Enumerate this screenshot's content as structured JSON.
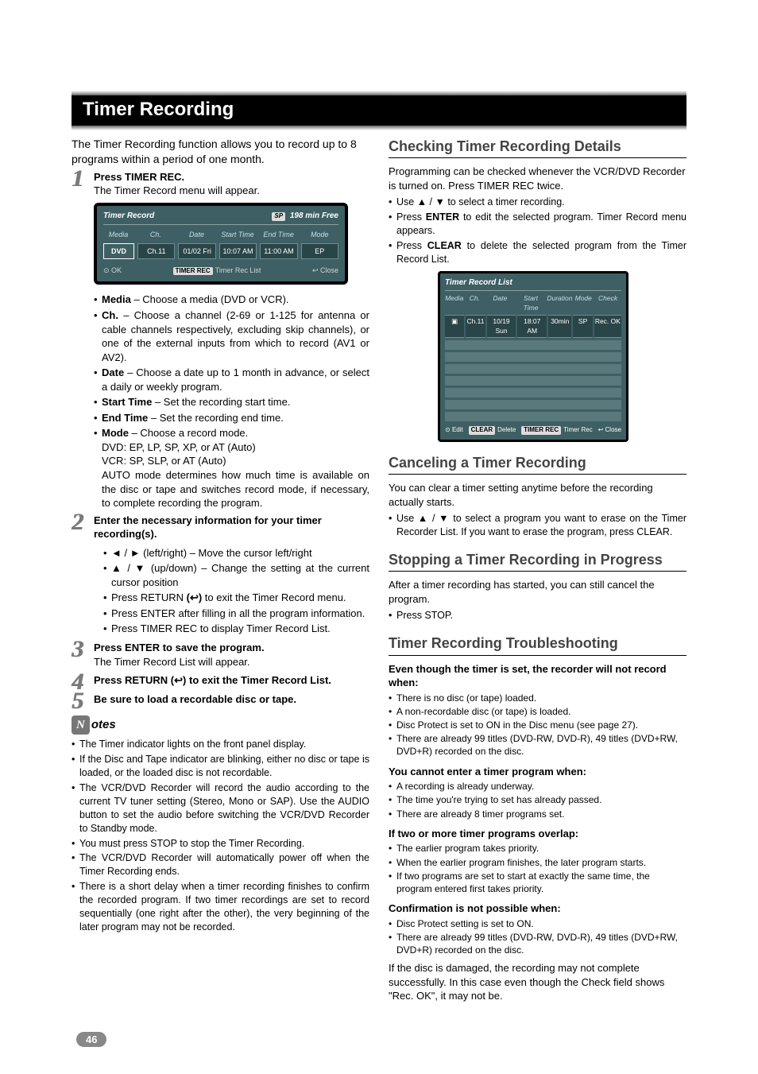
{
  "page": {
    "number": "46",
    "title": "Timer Recording"
  },
  "left": {
    "intro": "The Timer Recording function allows you to record up to 8 programs within a period of one month.",
    "step1": {
      "head": "Press TIMER REC.",
      "sub": "The Timer Record menu will appear."
    },
    "osd1": {
      "title": "Timer Record",
      "sp": "SP",
      "free": "198   min Free",
      "hdr": {
        "media": "Media",
        "ch": "Ch.",
        "date": "Date",
        "start": "Start Time",
        "end": "End Time",
        "mode": "Mode"
      },
      "row": {
        "media": "DVD",
        "ch": "Ch.11",
        "date": "01/02 Fri",
        "start": "10:07 AM",
        "end": "11:00 AM",
        "mode": "EP"
      },
      "foot": {
        "ok": "OK",
        "kbd": "TIMER REC",
        "list": "Timer Rec List",
        "close": "Close"
      }
    },
    "defs": {
      "media_b": "Media",
      "media_t": " – Choose a media (DVD or VCR).",
      "ch_b": "Ch.",
      "ch_t": " – Choose a channel (2-69 or 1-125 for antenna or cable channels respectively, excluding skip channels), or one of the external inputs from which to record (AV1 or AV2).",
      "date_b": "Date",
      "date_t": " – Choose a date up to 1 month in advance, or select a daily or weekly program.",
      "start_b": "Start Time",
      "start_t": " – Set the recording start time.",
      "end_b": "End Time",
      "end_t": " – Set the recording end time.",
      "mode_b": "Mode",
      "mode_t": " – Choose a record mode.",
      "mode_l1": "DVD: EP, LP, SP, XP, or AT (Auto)",
      "mode_l2": "VCR: SP, SLP, or AT (Auto)",
      "mode_l3": "AUTO mode determines how much time is available on the disc or tape and switches record mode, if necessary, to complete recording the program."
    },
    "step2": {
      "head": "Enter the necessary information for your timer recording(s).",
      "li1": "◄ / ► (left/right) – Move the cursor left/right",
      "li2": "▲ / ▼ (up/down) – Change the setting at the current cursor position",
      "li3a": "Press RETURN ",
      "li3b": "(↩)",
      "li3c": " to exit the Timer Record menu.",
      "li4": "Press ENTER after filling in all the program information.",
      "li5": "Press TIMER REC to display Timer Record List."
    },
    "step3": {
      "head": "Press ENTER to save the program.",
      "sub": "The Timer Record List will appear."
    },
    "step4": {
      "a": "Press RETURN (",
      "b": "↩",
      "c": ") to exit the Timer Record List."
    },
    "step5": "Be sure to load a recordable disc or tape.",
    "notes_head": "otes",
    "notes": {
      "n1": "The Timer indicator lights on the front panel display.",
      "n2": "If the Disc and Tape indicator are blinking, either no disc or tape is loaded, or the loaded disc is not recordable.",
      "n3": "The VCR/DVD Recorder will record the audio according to the current TV tuner setting (Stereo, Mono or SAP). Use the AUDIO button to set the audio before switching the VCR/DVD Recorder to Standby mode.",
      "n4": "You must press STOP to stop the Timer Recording.",
      "n5": "The VCR/DVD Recorder will automatically power off when the Timer Recording ends.",
      "n6": "There is a short delay when a timer recording finishes to confirm the recorded program. If two timer recordings are set to record sequentially (one right after the other), the very beginning of the later program may not be recorded."
    }
  },
  "right": {
    "check": {
      "head": "Checking Timer Recording Details",
      "p1": "Programming can be checked whenever the VCR/DVD Recorder is turned on. Press TIMER REC twice.",
      "li1": "Use ▲ / ▼ to select a timer recording.",
      "li2a": "Press ",
      "li2b": "ENTER",
      "li2c": " to edit the selected program. Timer Record menu appears.",
      "li3a": "Press ",
      "li3b": "CLEAR",
      "li3c": " to delete the selected program from the Timer Record List."
    },
    "osd2": {
      "title": "Timer Record List",
      "hdr": {
        "media": "Media",
        "ch": "Ch.",
        "date": "Date",
        "start": "Start Time",
        "dur": "Duration",
        "mode": "Mode",
        "check": "Check"
      },
      "row": {
        "media": "▣",
        "ch": "Ch.11",
        "date": "10/19 Sun",
        "start": "18:07 AM",
        "dur": "30min",
        "mode": "SP",
        "check": "Rec. OK"
      },
      "foot": {
        "edit": "Edit",
        "clear": "CLEAR",
        "delete": "Delete",
        "kbd": "TIMER REC",
        "list": "Timer Rec",
        "close": "Close"
      }
    },
    "cancel": {
      "head": "Canceling a Timer Recording",
      "p": "You can clear a timer setting anytime before the recording actually starts.",
      "li": "Use ▲ / ▼ to select a program you want to erase on the Timer Recorder List. If you want to erase the program, press CLEAR."
    },
    "stop": {
      "head": "Stopping a Timer Recording in Progress",
      "p": "After a timer recording has started, you can still cancel the program.",
      "li": "Press STOP."
    },
    "tshoot": {
      "head": "Timer Recording Troubleshooting",
      "s1": "Even though the timer is set, the recorder will not record when:",
      "s1l1": "There is no disc (or tape) loaded.",
      "s1l2": "A non-recordable disc (or tape) is loaded.",
      "s1l3": "Disc Protect is set to ON in the Disc menu (see page 27).",
      "s1l4": "There are already 99 titles (DVD-RW, DVD-R), 49 titles (DVD+RW, DVD+R) recorded on the disc.",
      "s2": "You cannot enter a timer program when:",
      "s2l1": "A recording is already underway.",
      "s2l2": "The time you're trying to set has already passed.",
      "s2l3": "There are already 8 timer programs set.",
      "s3": "If two or more timer programs overlap:",
      "s3l1": "The earlier program takes priority.",
      "s3l2": "When the earlier program finishes, the later program starts.",
      "s3l3": "If two programs are set to start at exactly the same time, the program entered first takes priority.",
      "s4": "Confirmation is not possible when:",
      "s4l1": "Disc Protect setting is set to ON.",
      "s4l2": "There are already 99 titles (DVD-RW, DVD-R), 49 titles (DVD+RW, DVD+R) recorded on the disc.",
      "p": "If the disc is damaged, the recording may not complete successfully. In this case even though the Check field shows \"Rec. OK\", it may not be."
    }
  }
}
